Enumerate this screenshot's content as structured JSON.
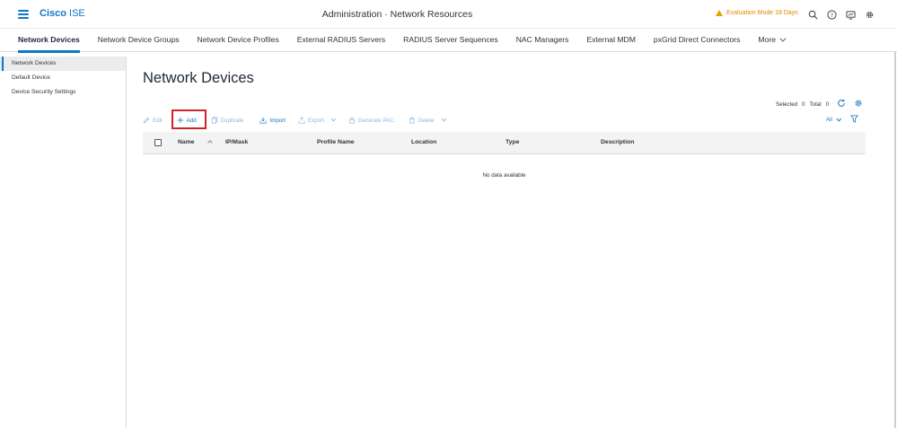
{
  "header": {
    "brand_bold": "Cisco",
    "brand_rest": "ISE",
    "page_title": "Administration · Network Resources",
    "evaluation_text": "Evaluation Mode 18 Days",
    "accent_color": "#0d78c2",
    "warning_color": "#e28700"
  },
  "tabs": [
    {
      "label": "Network Devices",
      "active": true
    },
    {
      "label": "Network Device Groups"
    },
    {
      "label": "Network Device Profiles"
    },
    {
      "label": "External RADIUS Servers"
    },
    {
      "label": "RADIUS Server Sequences"
    },
    {
      "label": "NAC Managers"
    },
    {
      "label": "External MDM"
    },
    {
      "label": "pxGrid Direct Connectors"
    },
    {
      "label": "More"
    }
  ],
  "sidebar": {
    "items": [
      {
        "label": "Network Devices",
        "active": true
      },
      {
        "label": "Default Device"
      },
      {
        "label": "Device Security Settings"
      }
    ]
  },
  "main": {
    "title": "Network Devices",
    "selected_label": "Selected",
    "selected_count": "0",
    "total_label": "Total",
    "total_count": "0",
    "toolbar": {
      "edit": "Edit",
      "add": "Add",
      "duplicate": "Duplicate",
      "import": "Import",
      "export": "Export",
      "generate_pac": "Generate PAC",
      "delete": "Delete"
    },
    "filter_all": "All",
    "columns": [
      "Name",
      "IP/Mask",
      "Profile Name",
      "Location",
      "Type",
      "Description"
    ],
    "empty_text": "No data available"
  }
}
